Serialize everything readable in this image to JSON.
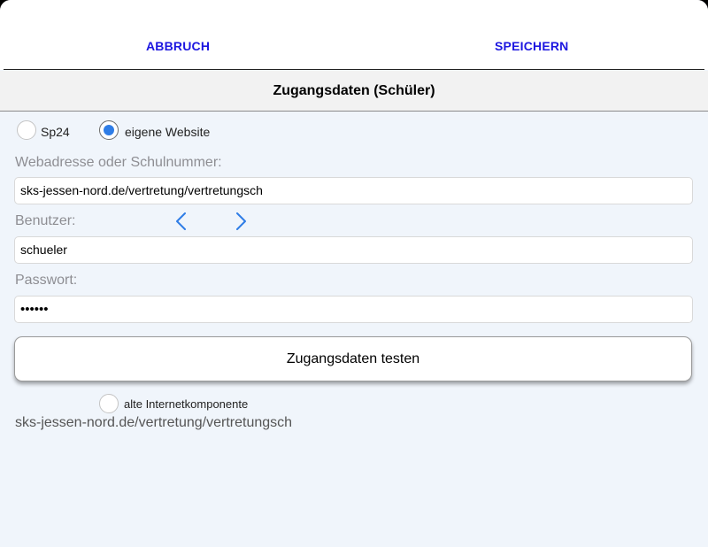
{
  "header": {
    "cancel_label": "ABBRUCH",
    "save_label": "SPEICHERN"
  },
  "title": "Zugangsdaten (Schüler)",
  "source_options": [
    {
      "label": "Sp24",
      "selected": false
    },
    {
      "label": "eigene Website",
      "selected": true
    }
  ],
  "fields": {
    "address_label": "Webadresse oder Schulnummer:",
    "address_value": "sks-jessen-nord.de/vertretung/vertretungsch",
    "user_label": "Benutzer:",
    "user_value": "schueler",
    "password_label": "Passwort:",
    "password_value": "••••••"
  },
  "nav_icons": [
    "chevron-left-icon",
    "chevron-right-icon"
  ],
  "test_button_label": "Zugangsdaten testen",
  "legacy_option": {
    "label": "alte Internetkomponente",
    "selected": false
  },
  "resolved_url": "sks-jessen-nord.de/vertretung/vertretungsch",
  "colors": {
    "accent": "#1c16e0",
    "radio_selected": "#2f7de6",
    "chevron": "#2f7de6",
    "background": "#f0f5fb"
  }
}
